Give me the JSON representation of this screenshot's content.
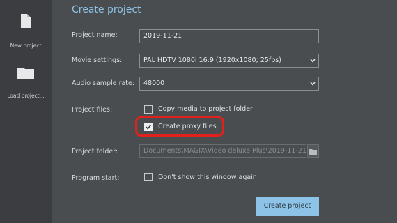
{
  "sidebar": {
    "items": [
      {
        "label": "New project",
        "icon": "new-file-icon"
      },
      {
        "label": "Load project...",
        "icon": "folder-icon"
      }
    ]
  },
  "dialog": {
    "title": "Create project",
    "project_name": {
      "label": "Project name:",
      "value": "2019-11-21"
    },
    "movie_settings": {
      "label": "Movie settings:",
      "value": "PAL HDTV 1080i 16:9 (1920x1080; 25fps)"
    },
    "audio_sample_rate": {
      "label": "Audio sample rate:",
      "value": "48000"
    },
    "project_files": {
      "label": "Project files:",
      "copy_media": {
        "label": "Copy media to project folder",
        "checked": false
      },
      "create_proxy": {
        "label": "Create proxy files",
        "checked": true
      }
    },
    "project_folder": {
      "label": "Project folder:",
      "value": "Documents\\MAGIX\\Video deluxe Plus\\2019-11-21\\"
    },
    "program_start": {
      "label": "Program start:",
      "dont_show": {
        "label": "Don't show this window again",
        "checked": false
      }
    },
    "create_button": "Create project"
  },
  "colors": {
    "accent": "#8ec3e8",
    "highlight": "#e2211c",
    "background": "#4a4d50",
    "sidebar": "#3b3d40"
  }
}
